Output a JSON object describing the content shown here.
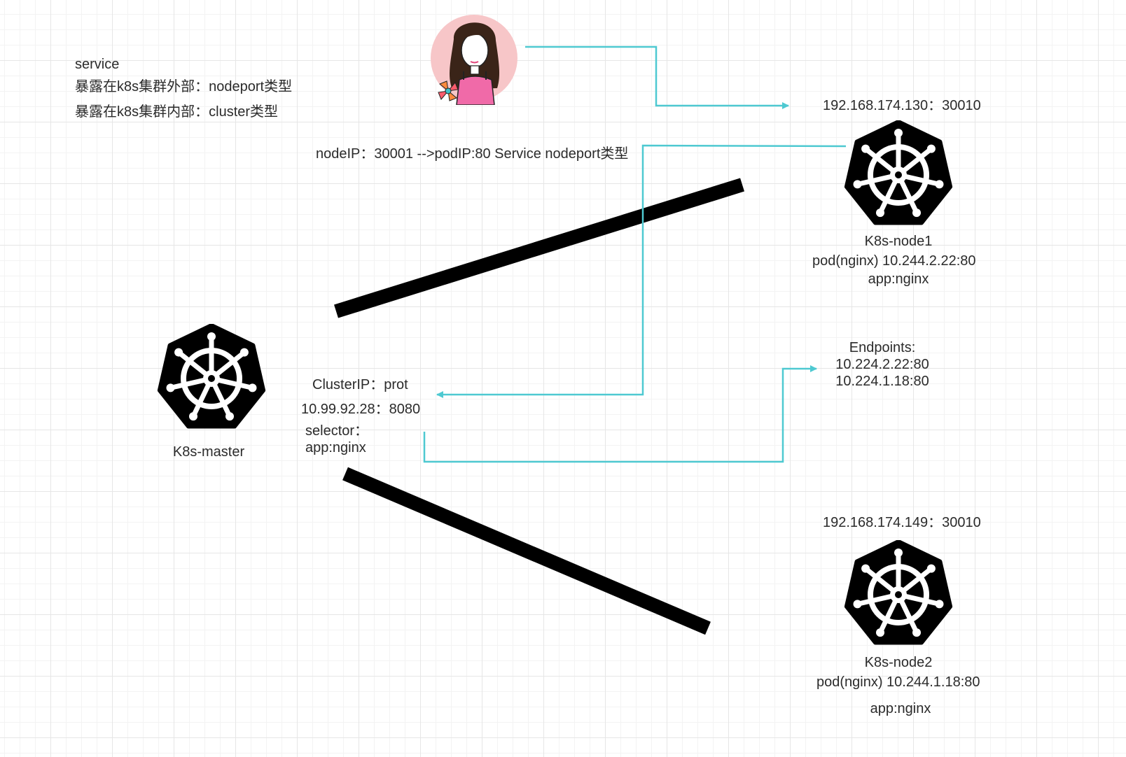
{
  "legend": {
    "line1": "service",
    "line2": "暴露在k8s集群外部：nodeport类型",
    "line3": "暴露在k8s集群内部：cluster类型"
  },
  "nodeport_label": "nodeIP：30001 -->podIP:80 Service nodeport类型",
  "node1": {
    "address": "192.168.174.130：30010",
    "name": "K8s-node1",
    "pod": "pod(nginx)  10.244.2.22:80",
    "label": "app:nginx"
  },
  "node2": {
    "address": "192.168.174.149：30010",
    "name": "K8s-node2",
    "pod": "pod(nginx) 10.244.1.18:80",
    "label": "app:nginx"
  },
  "master": {
    "name": "K8s-master"
  },
  "service": {
    "cluster_ip_title": "ClusterIP：prot",
    "cluster_ip": "10.99.92.28：8080",
    "selector_title": "selector：",
    "selector_value": "app:nginx"
  },
  "endpoints": {
    "title": "Endpoints:",
    "items": [
      "10.224.2.22:80",
      "10.224.1.18:80"
    ]
  },
  "colors": {
    "arrow": "#4ec9d1",
    "link": "#000000",
    "icon": "#000000"
  },
  "icons": {
    "node": "kubernetes-helm-icon",
    "user": "user-avatar-icon"
  }
}
